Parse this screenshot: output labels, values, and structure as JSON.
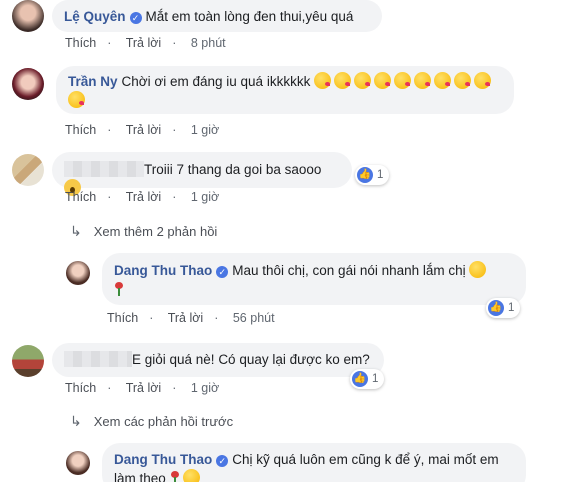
{
  "actions": {
    "like": "Thích",
    "reply": "Trả lời"
  },
  "comments": [
    {
      "name": "Lệ Quyên",
      "text": "Mắt em toàn lòng đen thui,yêu quá",
      "time": "8 phút"
    },
    {
      "name": "Trần Ny",
      "text": "Chời ơi em đáng iu quá ikkkkkk",
      "time": "1 giờ"
    },
    {
      "name": "",
      "text": "Troiii 7 thang da goi ba saooo",
      "time": "1 giờ",
      "likes": "1"
    },
    {
      "name": "Dang Thu Thao",
      "text": "Mau thôi chị, con gái nói nhanh lắm chị",
      "time": "56 phút",
      "likes": "1"
    },
    {
      "name": "",
      "text": "E giỏi quá nè! Có quay lại được ko em?",
      "time": "1 giờ",
      "likes": "1"
    },
    {
      "name": "Dang Thu Thao",
      "text": "Chị kỹ quá luôn em cũng k để ý, mai mốt em làm theo"
    }
  ],
  "more_replies": "Xem thêm 2 phản hồi",
  "previous_replies": "Xem các phản hồi trước",
  "icons": [
    "verified-badge-icon",
    "like-reaction-icon",
    "reply-arrow-icon",
    "kiss-emoji-icon",
    "rose-emoji-icon"
  ],
  "colors": {
    "name_link": "#385898",
    "bubble": "#f2f3f5",
    "like_blue": "#4a76e3"
  }
}
